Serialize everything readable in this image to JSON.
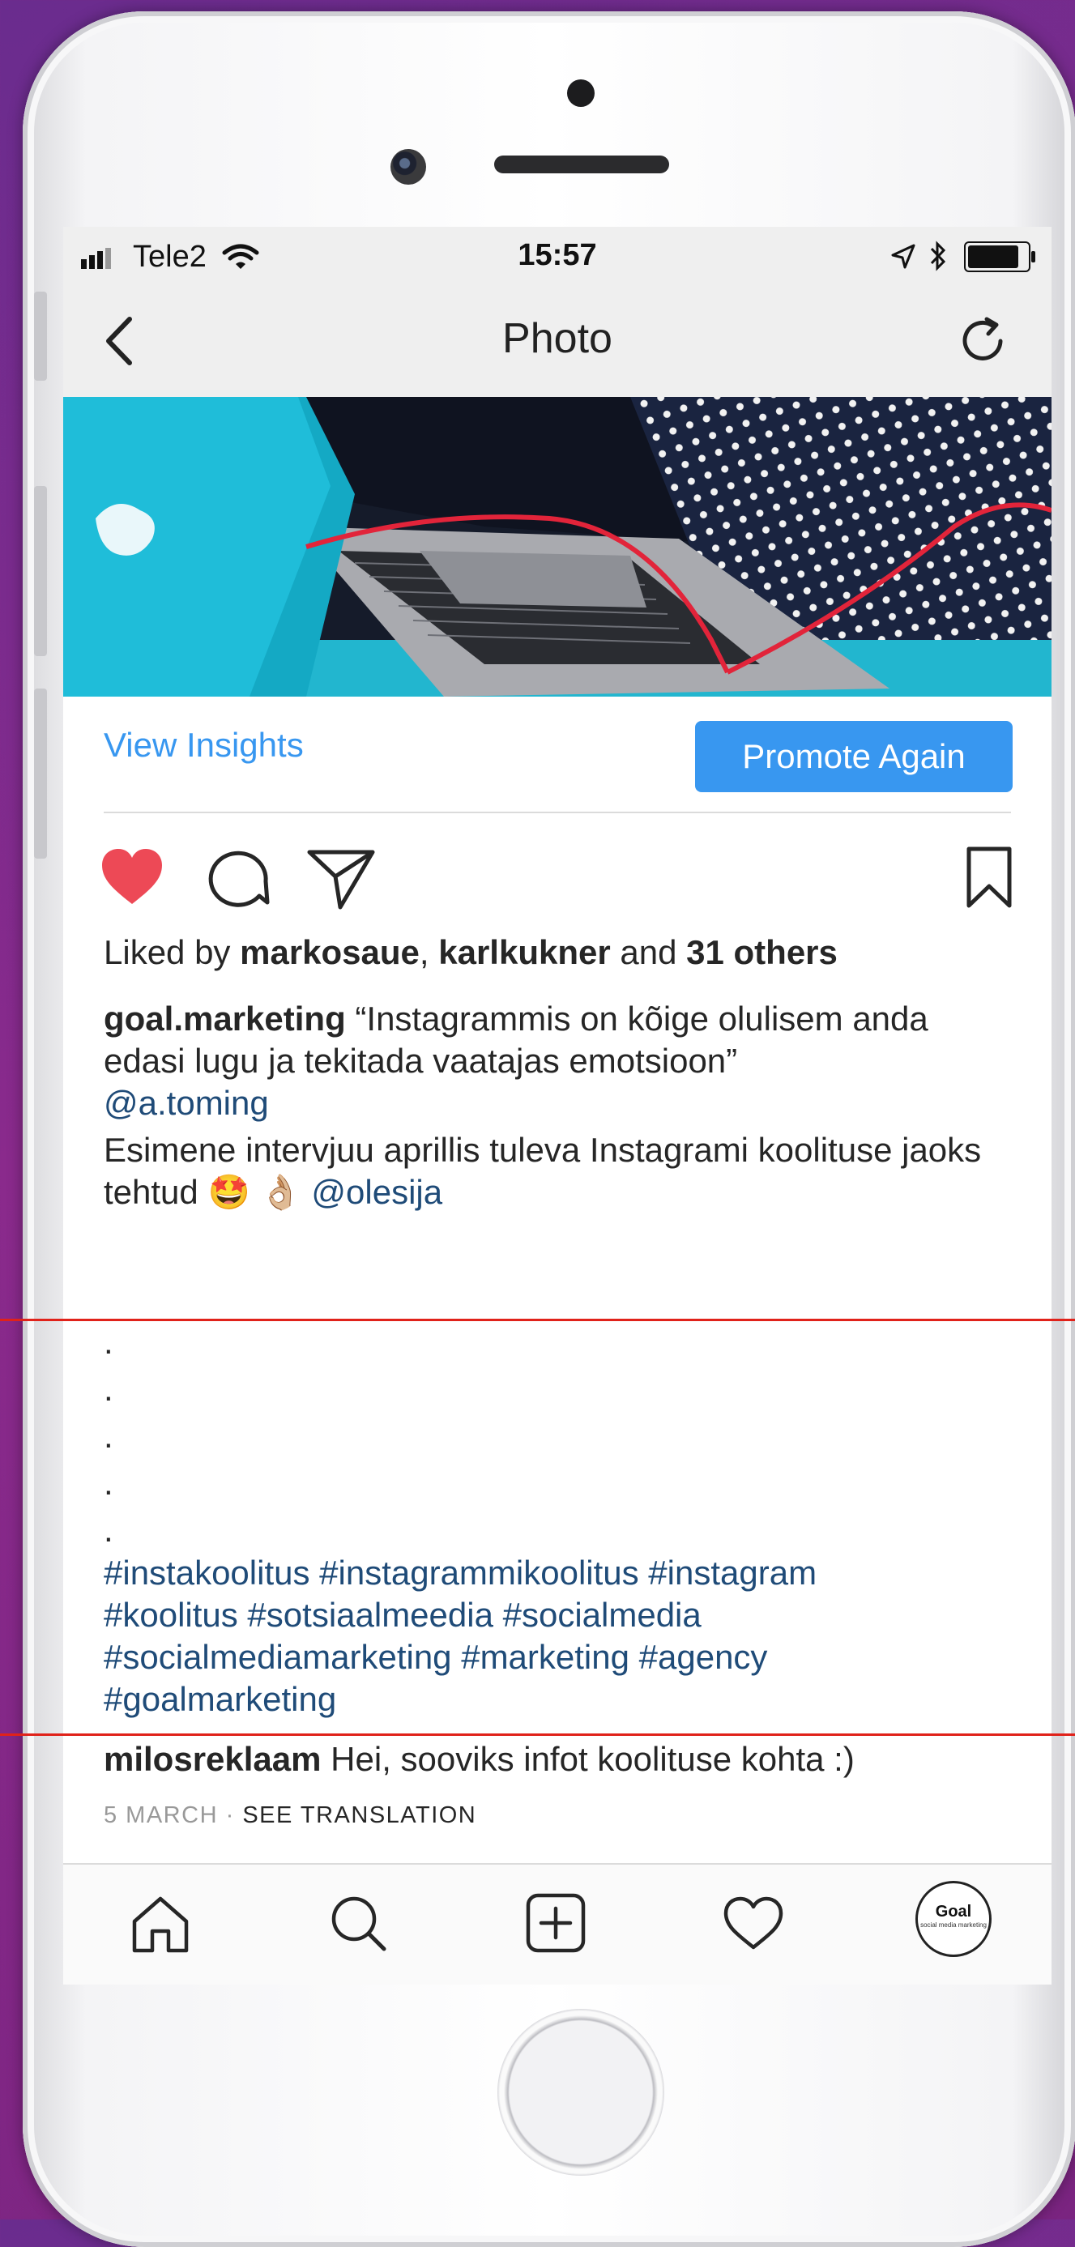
{
  "status_bar": {
    "carrier": "Tele2",
    "time": "15:57"
  },
  "nav": {
    "title": "Photo"
  },
  "insights": {
    "view_insights": "View Insights",
    "promote_again": "Promote Again"
  },
  "likes": {
    "prefix": "Liked by",
    "user1": "markosaue",
    "sep": ",",
    "user2": "karlkukner",
    "and": "and",
    "others": "31 others"
  },
  "caption": {
    "author": "goal.marketing",
    "quote": "“Instagrammis on kõige olulisem anda edasi lugu ja tekitada vaatajas emotsioon”",
    "mention1": "@a.toming",
    "text": "Esimene intervjuu aprillis tuleva Instagrami koolituse jaoks tehtud",
    "emoji": "🤩 👌🏼",
    "mention2": "@olesija",
    "dots": [
      ".",
      ".",
      ".",
      ".",
      "."
    ],
    "hashtags": [
      "#instakoolitus #instagrammikoolitus #instagram",
      "#koolitus #sotsiaalmeedia #socialmedia",
      "#socialmediamarketing #marketing #agency",
      "#goalmarketing"
    ]
  },
  "comment": {
    "user": "milosreklaam",
    "text": "Hei, sooviks infot koolituse kohta :)",
    "date": "5 MARCH",
    "separator": "·",
    "see_translation": "SEE TRANSLATION"
  },
  "avatar": {
    "brand": "Goal",
    "tagline": "social media marketing"
  },
  "colors": {
    "accent_blue": "#3897f0",
    "link_blue": "#1f4b78",
    "heart_red": "#ed4956",
    "highlight_line": "#e0221a"
  }
}
